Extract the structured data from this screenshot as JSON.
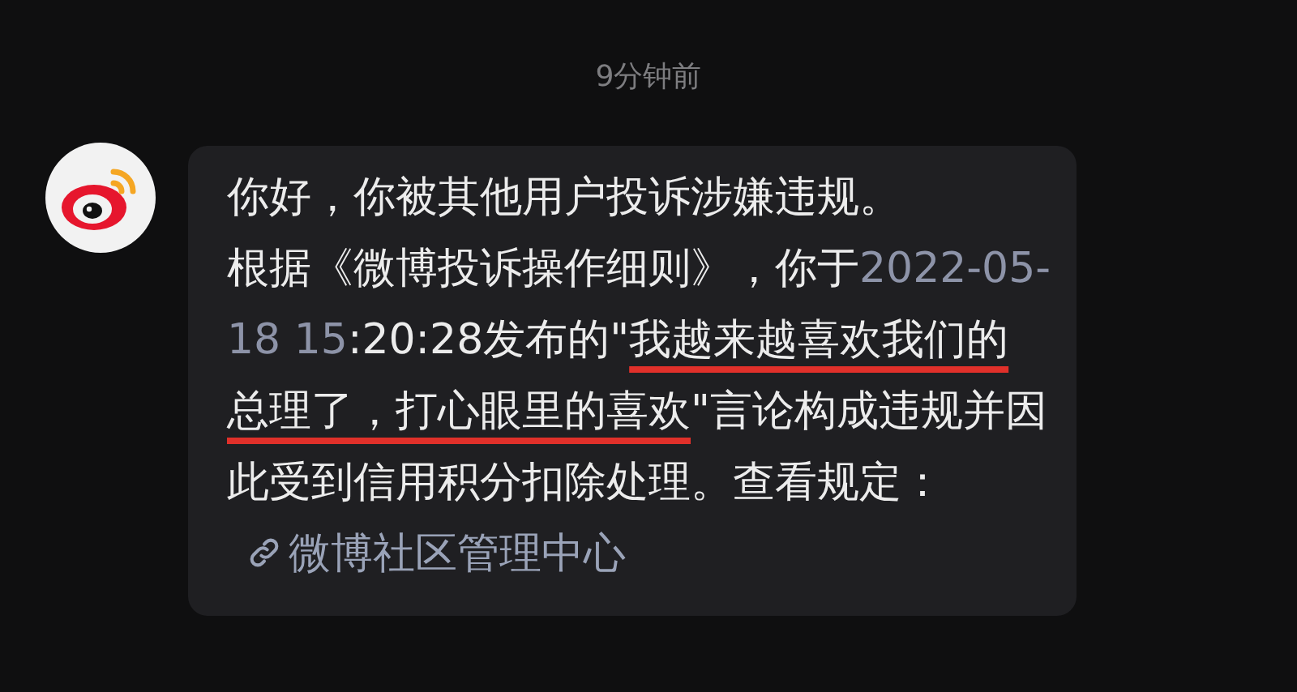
{
  "timestamp": "9分钟前",
  "message": {
    "greeting": "你好，你被其他用户投诉涉嫌违规。",
    "segments": [
      {
        "kind": "text",
        "text": "根据《微博投诉操作细则》，你于"
      },
      {
        "kind": "date",
        "text": "2022-05-18 15"
      },
      {
        "kind": "text",
        "text": ":20:28发布的\""
      },
      {
        "kind": "marked",
        "text": "我越来越喜欢我们的总理了，打心眼里的喜欢"
      },
      {
        "kind": "text",
        "text": "\"言论构成违规并因此受到信用积分扣除处理。查看规定："
      },
      {
        "kind": "link",
        "text": "微博社区管理中心"
      }
    ]
  }
}
